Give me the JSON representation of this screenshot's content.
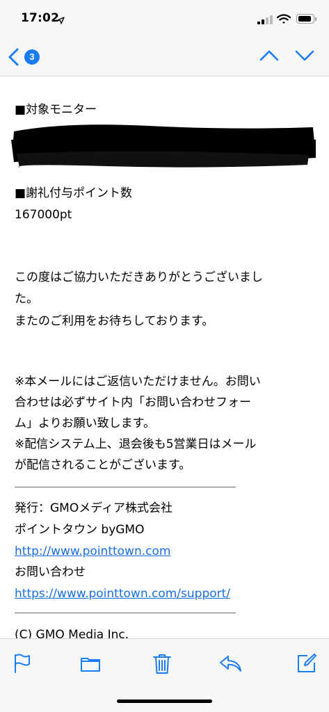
{
  "status_bar": {
    "time": "17:02",
    "icons": [
      "location-arrow-icon",
      "cellular-signal-icon",
      "wifi-icon",
      "battery-icon"
    ]
  },
  "nav": {
    "back_badge_count": "3",
    "icons": [
      "back-chevron-icon",
      "previous-message-icon",
      "next-message-icon"
    ],
    "accent_color": "#1a7cf5"
  },
  "email": {
    "monitor_heading": "■対象モニター",
    "points_heading": "■謝礼付与ポイント数",
    "points_value": "167000pt",
    "thanks_line1": "この度はご協力いただきありがとうございまし",
    "thanks_line2": "た。",
    "thanks_line3": "またのご利用をお待ちしております。",
    "notice_line1": "※本メールにはご返信いただけません。お問い",
    "notice_line2": "合わせは必ずサイト内「お問い合わせフォー",
    "notice_line3": "ム」よりお願い致します。",
    "notice_line4": "※配信システム上、退会後も5営業日はメール",
    "notice_line5": "が配信されることがございます。",
    "publisher": "発行：GMOメディア株式会社",
    "service_name": "ポイントタウン byGMO",
    "site_link": "http://www.pointtown.com",
    "contact_label": "お問い合わせ",
    "support_link": "https://www.pointtown.com/support/",
    "copyright": "(C) GMO Media Inc."
  },
  "toolbar": {
    "icons": [
      "flag-icon",
      "folder-icon",
      "trash-icon",
      "reply-icon",
      "compose-icon"
    ],
    "icon_color": "#1a7cf5"
  }
}
